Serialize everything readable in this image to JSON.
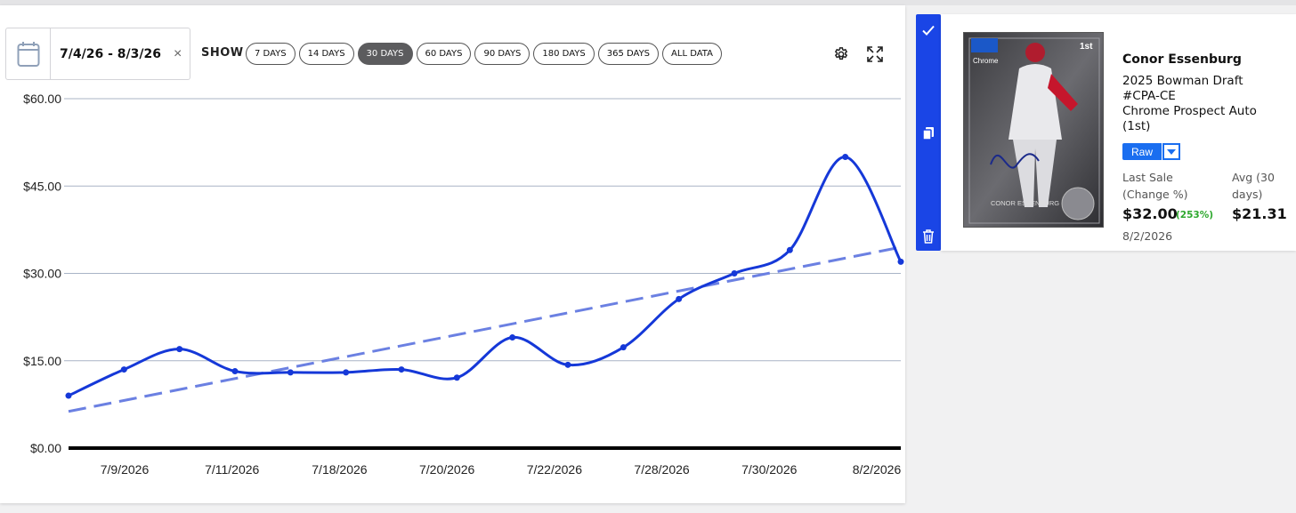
{
  "toolbar": {
    "date_range": "7/4/26 - 8/3/26",
    "clear_symbol": "×",
    "show_label": "SHOW",
    "ranges": [
      "7 DAYS",
      "14 DAYS",
      "30 DAYS",
      "60 DAYS",
      "90 DAYS",
      "180 DAYS",
      "365 DAYS",
      "ALL DATA"
    ],
    "active_range": "30 DAYS",
    "icons": [
      "calendar-icon",
      "gear-icon",
      "expand-icon"
    ]
  },
  "chart_data": {
    "type": "line",
    "title": "",
    "xlabel": "",
    "ylabel": "",
    "ylim": [
      0,
      60
    ],
    "yticks": [
      "$60.00",
      "$45.00",
      "$30.00",
      "$15.00",
      "$0.00"
    ],
    "x_tick_labels": [
      "7/9/2026",
      "7/11/2026",
      "7/18/2026",
      "7/20/2026",
      "7/22/2026",
      "7/28/2026",
      "7/30/2026",
      "8/2/2026"
    ],
    "grid": true,
    "series": [
      {
        "values": [
          9.0,
          13.5,
          17.0,
          13.2,
          13.0,
          13.0,
          13.5,
          12.1,
          19.0,
          14.3,
          17.3,
          25.6,
          30.0,
          34.0,
          50.0,
          32.0
        ],
        "color": "#1538d8"
      }
    ],
    "trendline": {
      "start": 6.3,
      "end": 34.5,
      "color": "#6b80e2",
      "style": "dashed"
    }
  },
  "sidebar": {
    "icons": [
      "check-icon",
      "copy-icon",
      "trash-icon"
    ],
    "color": "#1a45e6"
  },
  "card": {
    "player_name": "Conor Essenburg",
    "desc_lines": [
      "2025 Bowman Draft",
      "#CPA-CE",
      "Chrome Prospect Auto",
      "(1st)"
    ],
    "grade": "Raw",
    "last_sale_label_1": "Last Sale",
    "last_sale_label_2": "(Change %)",
    "avg_label_1": "Avg (30",
    "avg_label_2": "days)",
    "last_sale_price": "$32.00",
    "change_pct": "(253%)",
    "avg_price": "$21.31",
    "sale_date": "8/2/2026",
    "image_caption": "CONOR ESSENBURG",
    "image_brand": "Chrome",
    "image_badge": "1st"
  }
}
